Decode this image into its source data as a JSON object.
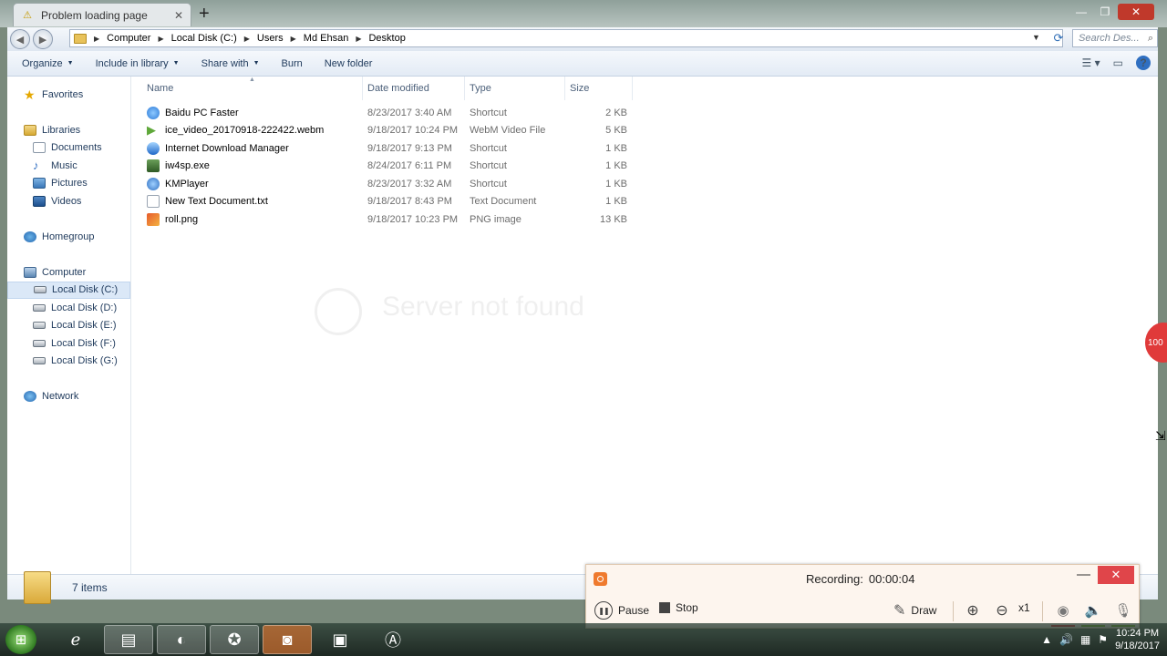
{
  "browser": {
    "tab_title": "Problem loading page",
    "tab_close": "✕",
    "new_tab": "+",
    "window_controls": {
      "min": "—",
      "max": "❐",
      "close": "✕"
    },
    "ghost_heading": "Server not found"
  },
  "explorer": {
    "breadcrumb": [
      "Computer",
      "Local Disk (C:)",
      "Users",
      "Md Ehsan",
      "Desktop"
    ],
    "search_placeholder": "Search Des...",
    "toolbar": {
      "organize": "Organize",
      "include_in_library": "Include in library",
      "share_with": "Share with",
      "burn": "Burn",
      "new_folder": "New folder"
    },
    "nav": {
      "favorites": "Favorites",
      "libraries": "Libraries",
      "documents": "Documents",
      "music": "Music",
      "pictures": "Pictures",
      "videos": "Videos",
      "homegroup": "Homegroup",
      "computer": "Computer",
      "drives": [
        "Local Disk (C:)",
        "Local Disk (D:)",
        "Local Disk (E:)",
        "Local Disk (F:)",
        "Local Disk (G:)"
      ],
      "network": "Network"
    },
    "columns": {
      "name": "Name",
      "date_modified": "Date modified",
      "type": "Type",
      "size": "Size"
    },
    "files": [
      {
        "name": "Baidu PC Faster",
        "date": "8/23/2017 3:40 AM",
        "type": "Shortcut",
        "size": "2 KB",
        "icon": "baidu-icon"
      },
      {
        "name": "ice_video_20170918-222422.webm",
        "date": "9/18/2017 10:24 PM",
        "type": "WebM Video File",
        "size": "5 KB",
        "icon": "webm-icon"
      },
      {
        "name": "Internet Download Manager",
        "date": "9/18/2017 9:13 PM",
        "type": "Shortcut",
        "size": "1 KB",
        "icon": "idm-icon"
      },
      {
        "name": "iw4sp.exe",
        "date": "8/24/2017 6:11 PM",
        "type": "Shortcut",
        "size": "1 KB",
        "icon": "iw4sp-icon"
      },
      {
        "name": "KMPlayer",
        "date": "8/23/2017 3:32 AM",
        "type": "Shortcut",
        "size": "1 KB",
        "icon": "kmplayer-icon"
      },
      {
        "name": "New Text Document.txt",
        "date": "9/18/2017 8:43 PM",
        "type": "Text Document",
        "size": "1 KB",
        "icon": "text-file-icon"
      },
      {
        "name": "roll.png",
        "date": "9/18/2017 10:23 PM",
        "type": "PNG image",
        "size": "13 KB",
        "icon": "png-file-icon"
      }
    ],
    "status": "7 items"
  },
  "recorder": {
    "status_label": "Recording:",
    "elapsed": "00:00:04",
    "pause": "Pause",
    "stop": "Stop",
    "draw": "Draw",
    "zoom_level": "x1"
  },
  "side_badge": "100",
  "taskbar": {
    "time": "10:24 PM",
    "date": "9/18/2017"
  }
}
